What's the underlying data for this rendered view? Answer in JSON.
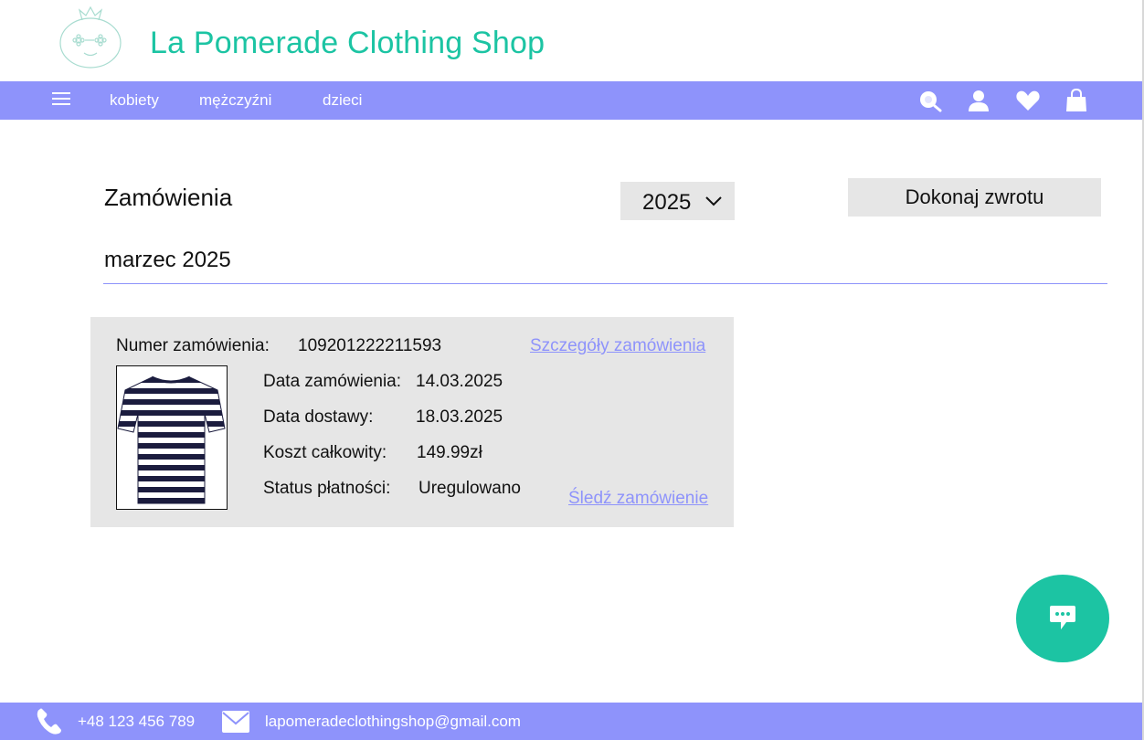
{
  "header": {
    "brand": "La Pomerade Clothing Shop",
    "logo_icon": "pomegranate-logo-icon"
  },
  "nav": {
    "menu_icon": "hamburger-menu-icon",
    "items": [
      {
        "label": "kobiety"
      },
      {
        "label": "mężczyźni"
      },
      {
        "label": "dzieci"
      }
    ],
    "icons": [
      "search-icon",
      "user-icon",
      "heart-icon",
      "bag-icon"
    ]
  },
  "orders": {
    "title": "Zamówienia",
    "year_selected": "2025",
    "return_button": "Dokonaj zwrotu",
    "month": "marzec 2025",
    "order": {
      "number_label": "Numer zamówienia:",
      "number_value": "109201222211593",
      "details_link": "Szczegóły zamówienia",
      "order_date_label": "Data zamówienia:",
      "order_date_value": "14.03.2025",
      "delivery_label": "Data dostawy:",
      "delivery_value": "18.03.2025",
      "total_label": "Koszt całkowity:",
      "total_value": "149.99zł",
      "payment_label": "Status płatności:",
      "payment_value": "Uregulowano",
      "track_link": "Śledź zamówienie",
      "image_icon": "striped-tshirt-image"
    }
  },
  "footer": {
    "phone": "+48 123 456 789",
    "email": "lapomeradeclothingshop@gmail.com"
  },
  "colors": {
    "accent": "#8e93fb",
    "brand": "#1cc4a3",
    "panel": "#e6e6e6"
  }
}
